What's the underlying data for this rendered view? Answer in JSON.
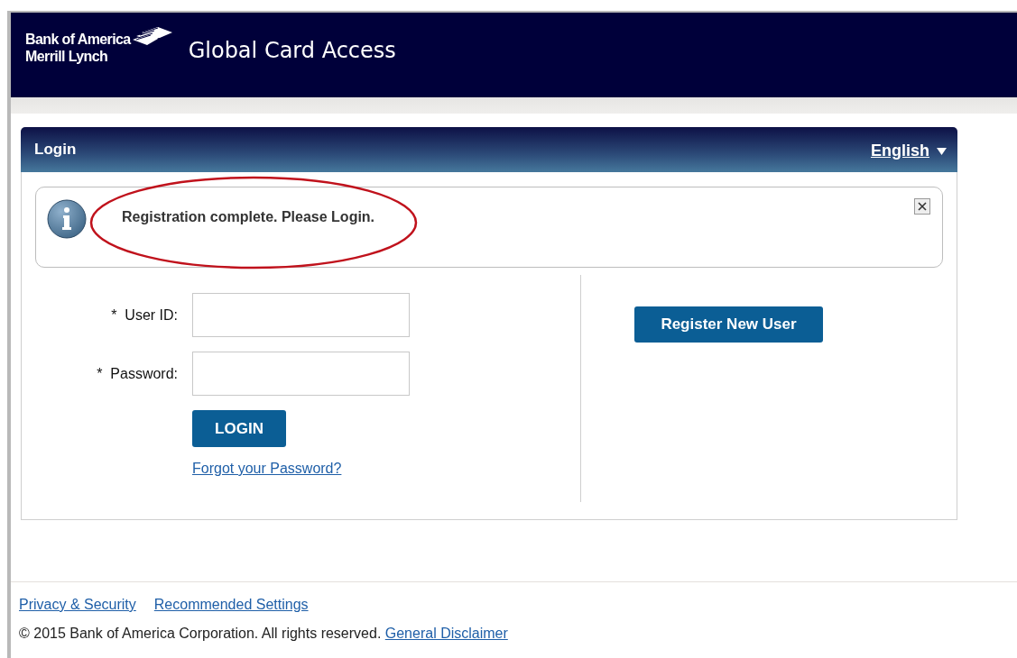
{
  "header": {
    "logo_lines": [
      "Bank of America",
      "Merrill Lynch"
    ],
    "title": "Global Card Access"
  },
  "panel": {
    "title": "Login",
    "language": "English"
  },
  "message": {
    "text": "Registration complete. Please Login.",
    "circled": true
  },
  "form": {
    "fields": [
      {
        "required_mark": "*",
        "label": "User ID:"
      },
      {
        "required_mark": "*",
        "label": "Password:"
      }
    ],
    "login_button": "LOGIN",
    "forgot_link": "Forgot your Password?"
  },
  "register_button": "Register New User",
  "footer": {
    "links": [
      "Privacy & Security",
      "Recommended Settings"
    ],
    "copyright": "© 2015 Bank of America Corporation. All rights reserved.",
    "disclaimer_link": "General Disclaimer"
  }
}
